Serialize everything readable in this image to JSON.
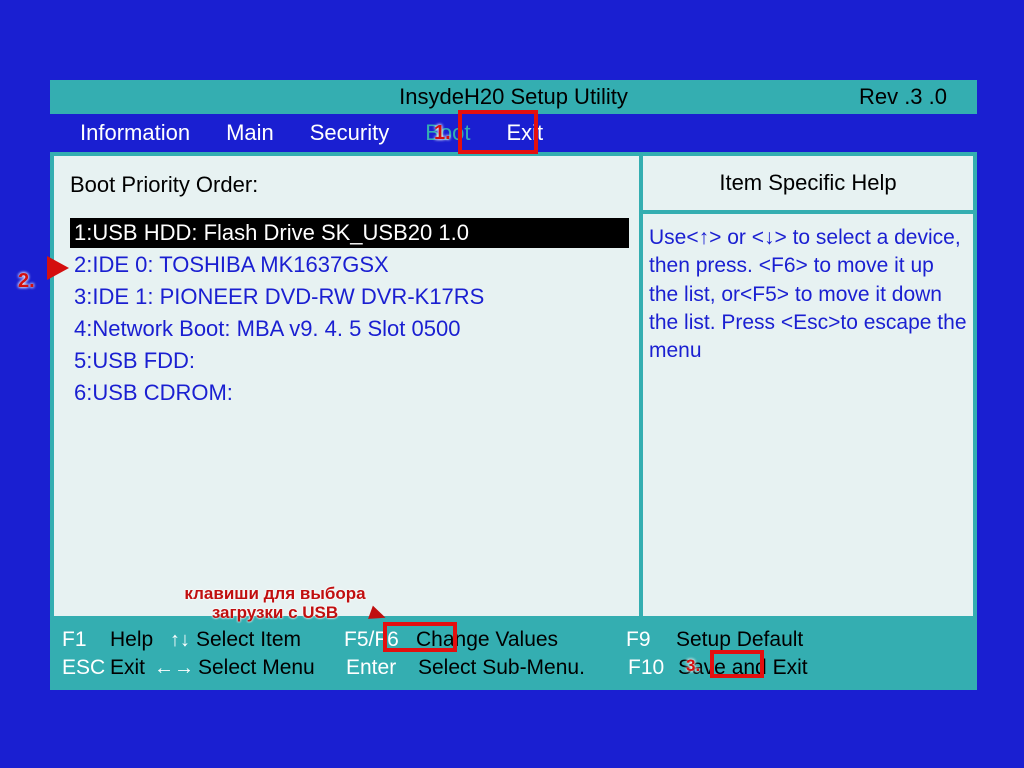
{
  "title": {
    "center": "InsydeH20  Setup  Utility",
    "rev": "Rev .3 .0"
  },
  "menu": {
    "items": [
      "Information",
      "Main",
      "Security",
      "Boot",
      "Exit"
    ],
    "active_index": 3
  },
  "left": {
    "heading": "Boot Priority Order:",
    "items": [
      "1:USB HDD:  Flash Drive  SK_USB20  1.0",
      "2:IDE 0: TOSHIBA MK1637GSX",
      "3:IDE 1: PIONEER DVD-RW  DVR-K17RS",
      "4:Network Boot:  MBA  v9. 4. 5  Slot  0500",
      "5:USB FDD:",
      "6:USB CDROM:"
    ],
    "selected_index": 0
  },
  "help": {
    "title": "Item Specific Help",
    "body": "Use<↑> or <↓> to select a device,  then press. <F6> to move it up the list, or<F5> to move it down the list. Press <Esc>to escape the menu"
  },
  "footer": {
    "row1": {
      "k1": "F1",
      "l1": "Help",
      "l2": "Select Item",
      "k3": "F5/F6",
      "l3": "Change Values",
      "k4": "F9",
      "l4": "Setup Default"
    },
    "row2": {
      "k1": "ESC",
      "l1": "Exit",
      "l2": "Select Menu",
      "k3": "Enter",
      "l3": "Select  Sub-Menu.",
      "k4": "F10",
      "l4": "Save and Exit"
    }
  },
  "annotations": {
    "n1": "1.",
    "n2": "2.",
    "n3": "3.",
    "caption_line1": "клавиши для выбора",
    "caption_line2": "загрузки с USB"
  }
}
